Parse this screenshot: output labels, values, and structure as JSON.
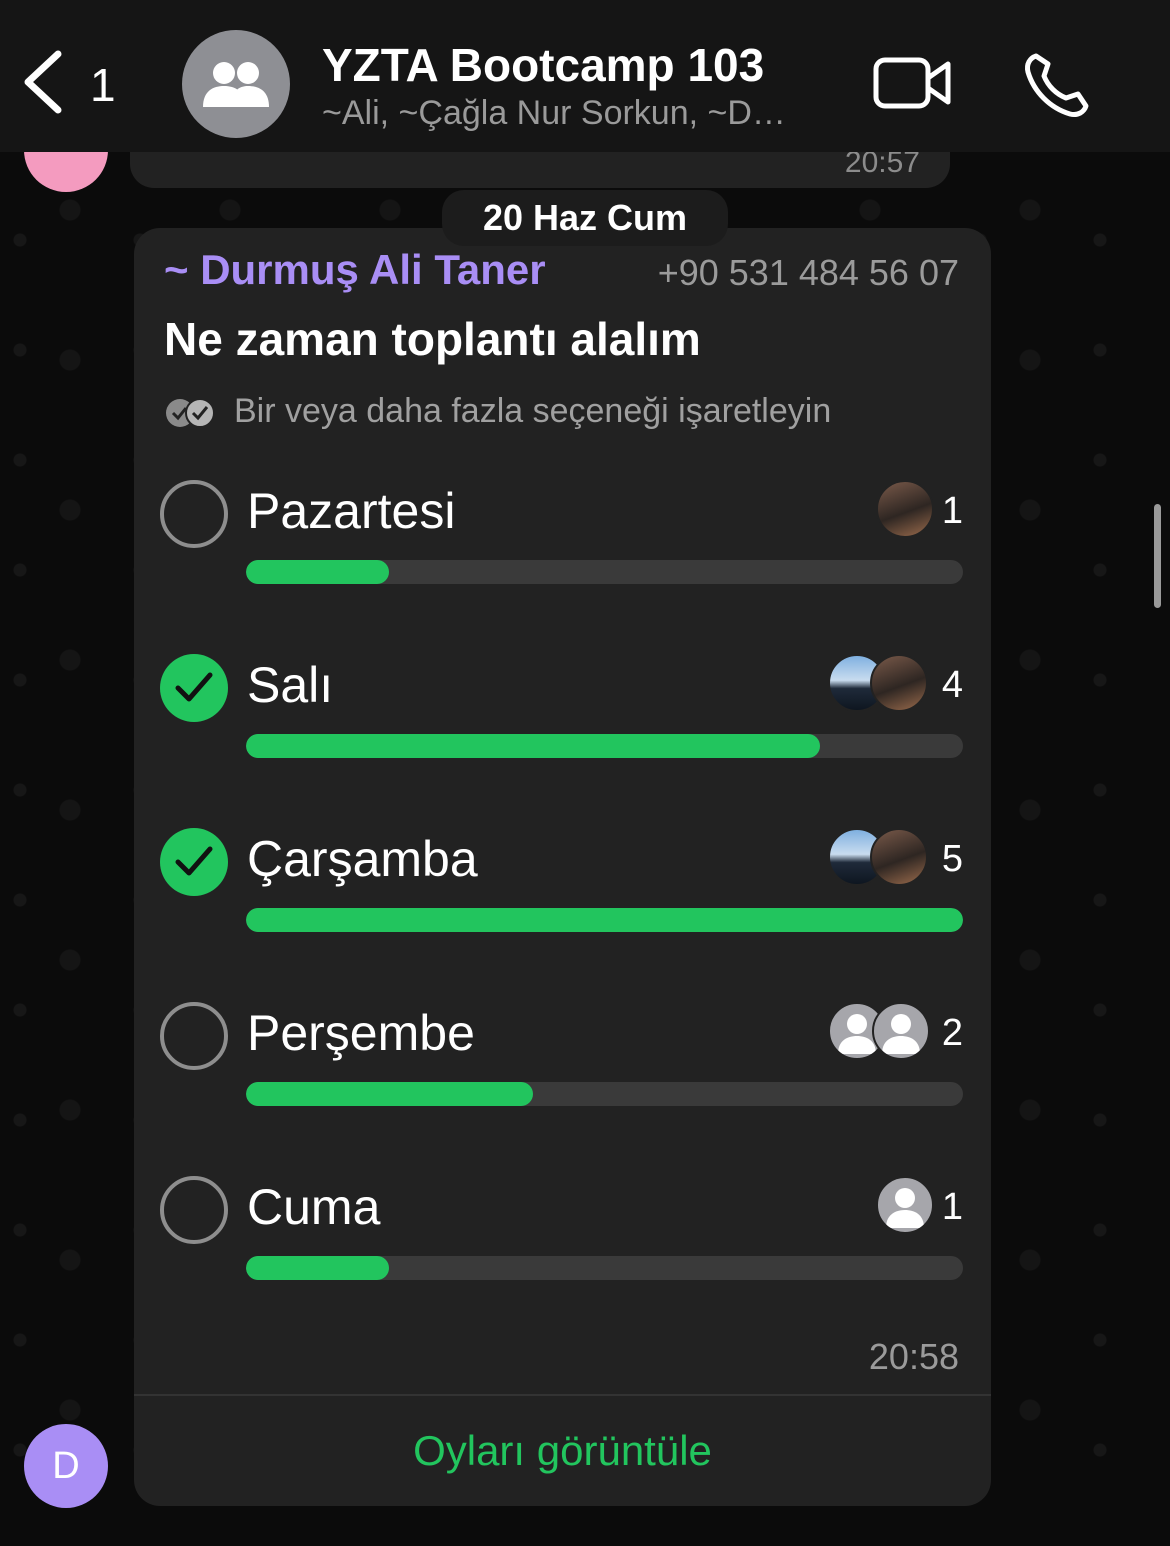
{
  "header": {
    "back_count": "1",
    "title": "YZTA Bootcamp 103",
    "subtitle": "~Ali, ~Çağla Nur Sorkun, ~D…",
    "icons": {
      "back": "chevron-left-icon",
      "group": "group-icon",
      "video": "video-call-icon",
      "phone": "phone-call-icon"
    }
  },
  "previous_message": {
    "time": "20:57"
  },
  "date_separator": "20 Haz Cum",
  "poll": {
    "sender_name": "~ Durmuş Ali Taner",
    "sender_phone": "+90 531 484 56 07",
    "question": "Ne zaman toplantı alalım",
    "hint": "Bir veya daha fazla seçeneği işaretleyin",
    "options": [
      {
        "label": "Pazartesi",
        "votes": "1",
        "checked": false,
        "fraction": 0.2
      },
      {
        "label": "Salı",
        "votes": "4",
        "checked": true,
        "fraction": 0.8
      },
      {
        "label": "Çarşamba",
        "votes": "5",
        "checked": true,
        "fraction": 1.0
      },
      {
        "label": "Perşembe",
        "votes": "2",
        "checked": false,
        "fraction": 0.4
      },
      {
        "label": "Cuma",
        "votes": "1",
        "checked": false,
        "fraction": 0.2
      }
    ],
    "time": "20:58",
    "view_votes_label": "Oyları görüntüle"
  },
  "composer_avatar_letter": "D",
  "colors": {
    "accent_green": "#22c55e",
    "sender_purple": "#a98ef5",
    "bubble": "#222222"
  }
}
